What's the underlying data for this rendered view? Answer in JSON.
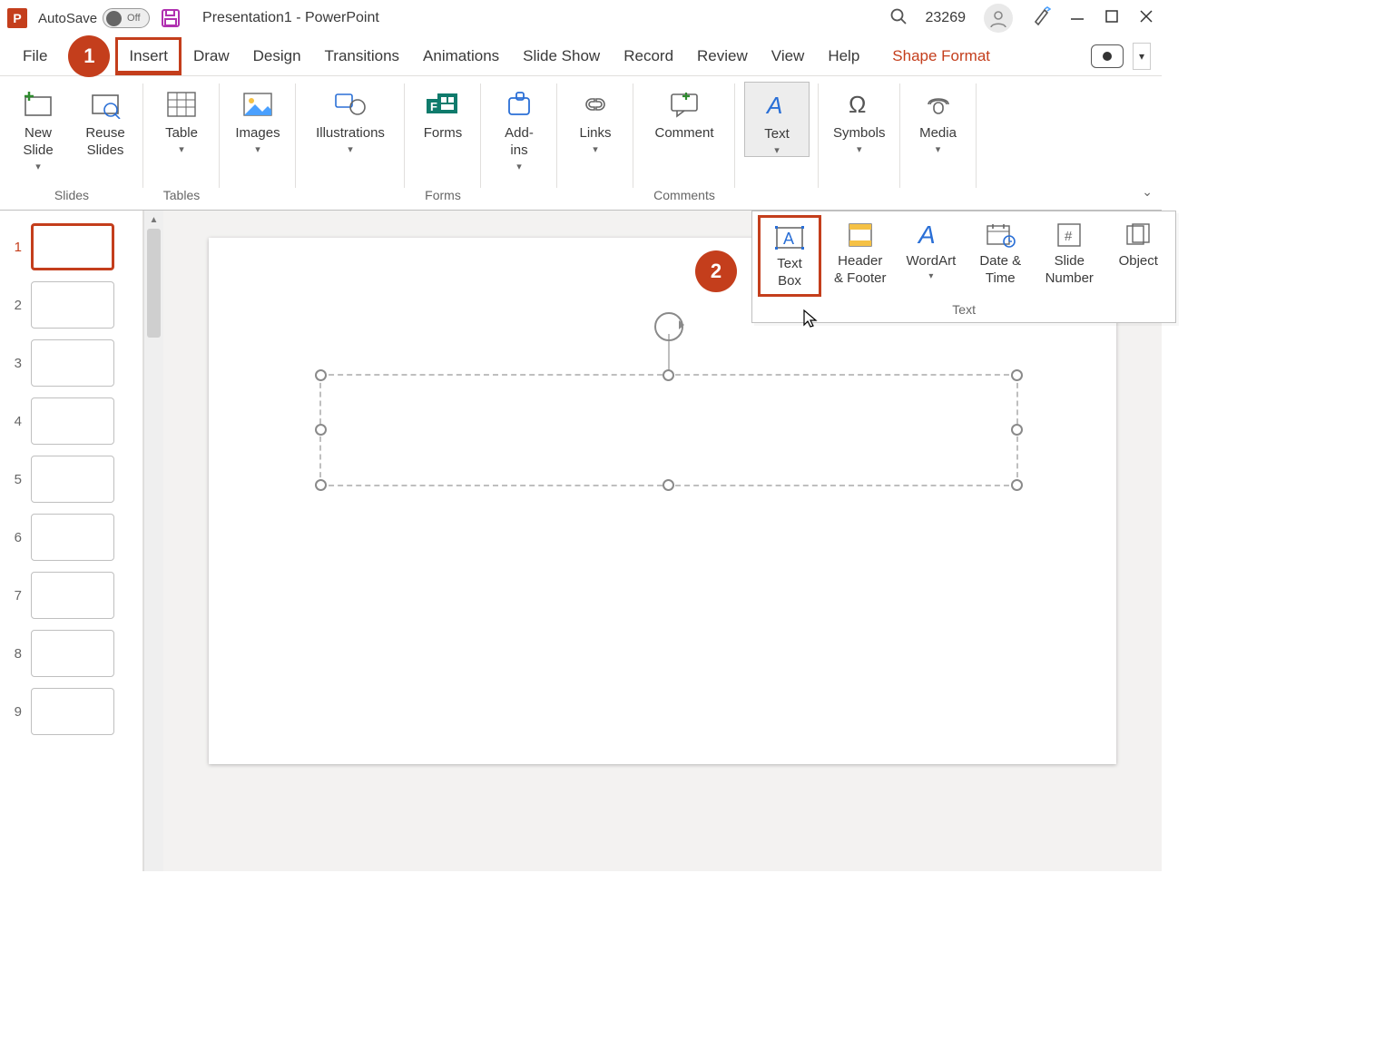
{
  "titlebar": {
    "autosave_label": "AutoSave",
    "autosave_state_label": "Off",
    "doc_title": "Presentation1  -  PowerPoint",
    "user_id": "23269"
  },
  "tabs": {
    "file": "File",
    "insert": "Insert",
    "draw": "Draw",
    "design": "Design",
    "transitions": "Transitions",
    "animations": "Animations",
    "slideshow": "Slide Show",
    "record": "Record",
    "review": "Review",
    "view": "View",
    "help": "Help",
    "shape_format": "Shape Format"
  },
  "callouts": {
    "one": "1",
    "two": "2"
  },
  "ribbon": {
    "groups": {
      "slides": {
        "label": "Slides",
        "new_slide": "New\nSlide",
        "reuse_slides": "Reuse\nSlides"
      },
      "tables": {
        "label": "Tables",
        "table": "Table"
      },
      "images": {
        "label": "",
        "images": "Images"
      },
      "illustrations": {
        "label": "",
        "illustrations": "Illustrations"
      },
      "forms": {
        "label": "Forms",
        "forms": "Forms"
      },
      "addins": {
        "label": "",
        "addins": "Add-\nins"
      },
      "links": {
        "label": "",
        "links": "Links"
      },
      "comments": {
        "label": "Comments",
        "comment": "Comment"
      },
      "text_btn": {
        "label": "",
        "text": "Text"
      },
      "symbols": {
        "label": "",
        "symbols": "Symbols"
      },
      "media": {
        "label": "",
        "media": "Media"
      }
    }
  },
  "text_popover": {
    "group_label": "Text",
    "textbox": "Text\nBox",
    "header_footer": "Header\n& Footer",
    "wordart": "WordArt",
    "date_time": "Date &\nTime",
    "slide_number": "Slide\nNumber",
    "object": "Object"
  },
  "thumbnails": {
    "count": 9,
    "selected": 1,
    "numbers": [
      "1",
      "2",
      "3",
      "4",
      "5",
      "6",
      "7",
      "8",
      "9"
    ]
  }
}
